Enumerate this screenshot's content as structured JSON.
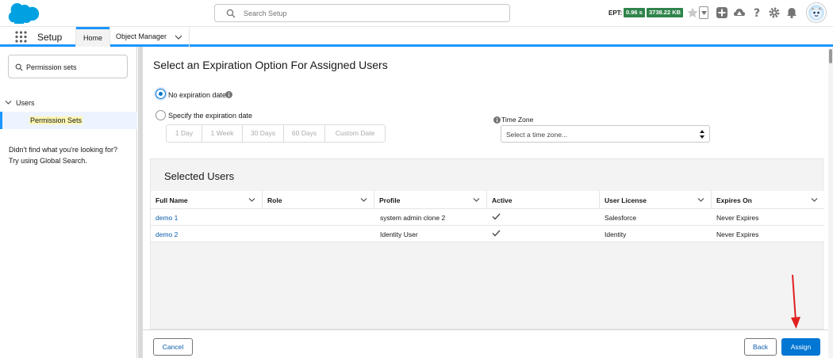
{
  "header": {
    "search_placeholder": "Search Setup",
    "ept_label": "EPT:",
    "ept_time": "0.96 s",
    "ept_size": "3738.22 KB",
    "icons": [
      "favorites-star-icon",
      "favorites-dropdown-icon",
      "global-actions-add-icon",
      "trailhead-guidance-icon",
      "help-icon",
      "setup-gear-icon",
      "notifications-bell-icon",
      "user-avatar"
    ]
  },
  "context_bar": {
    "app_name": "Setup",
    "tabs": [
      "Home",
      "Object Manager"
    ]
  },
  "sidebar": {
    "quick_find_value": "Permission sets",
    "tree": {
      "parent": "Users",
      "child": "Permission Sets"
    },
    "help_line1": "Didn't find what you're looking for?",
    "help_line2": "Try using Global Search."
  },
  "main": {
    "title": "Select an Expiration Option For Assigned Users",
    "option_no_expiration": "No expiration date",
    "option_specify": "Specify the expiration date",
    "durations": [
      "1 Day",
      "1 Week",
      "30 Days",
      "60 Days",
      "Custom Date"
    ],
    "time_zone_label": "Time Zone",
    "time_zone_placeholder": "Select a time zone..."
  },
  "selected_users": {
    "title": "Selected Users",
    "columns": [
      "Full Name",
      "Role",
      "Profile",
      "Active",
      "User License",
      "Expires On"
    ],
    "rows": [
      {
        "full_name": "demo 1",
        "role": "",
        "profile": "system admin clone 2",
        "active": true,
        "user_license": "Salesforce",
        "expires_on": "Never Expires"
      },
      {
        "full_name": "demo 2",
        "role": "",
        "profile": "Identity User",
        "active": true,
        "user_license": "Identity",
        "expires_on": "Never Expires"
      }
    ]
  },
  "footer": {
    "cancel_label": "Cancel",
    "back_label": "Back",
    "assign_label": "Assign"
  },
  "colors": {
    "brand": "#0176d3",
    "link": "#0b5cab",
    "ept_badge": "#2e844a",
    "annotation_arrow": "#e02020"
  }
}
